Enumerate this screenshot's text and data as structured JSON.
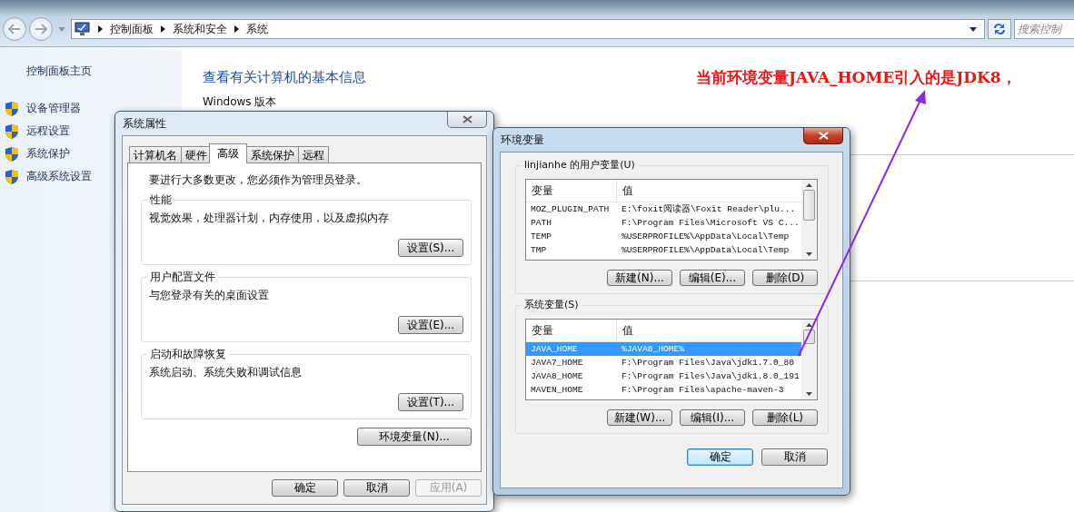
{
  "explorer": {
    "breadcrumb": [
      "控制面板",
      "系统和安全",
      "系统"
    ],
    "search": {
      "placeholder": "搜索控制"
    }
  },
  "sidebar": {
    "home_link": "控制面板主页",
    "items": [
      "设备管理器",
      "远程设置",
      "系统保护",
      "高级系统设置"
    ]
  },
  "main": {
    "heading": "查看有关计算机的基本信息",
    "section": "Windows 版本"
  },
  "annotation": "当前环境变量JAVA_HOME引入的是JDK8，",
  "system_properties": {
    "title": "系统属性",
    "tabs": [
      {
        "label": "计算机名",
        "selected": false
      },
      {
        "label": "硬件",
        "selected": false
      },
      {
        "label": "高级",
        "selected": true
      },
      {
        "label": "系统保护",
        "selected": false
      },
      {
        "label": "远程",
        "selected": false
      }
    ],
    "notice": "要进行大多数更改，您必须作为管理员登录。",
    "groups": [
      {
        "title": "性能",
        "description": "视觉效果，处理器计划，内存使用，以及虚拟内存",
        "button": "设置(S)..."
      },
      {
        "title": "用户配置文件",
        "description": "与您登录有关的桌面设置",
        "button": "设置(E)..."
      },
      {
        "title": "启动和故障恢复",
        "description": "系统启动、系统失败和调试信息",
        "button": "设置(T)..."
      }
    ],
    "env_button": "环境变量(N)...",
    "buttons": [
      {
        "label": "确定",
        "disabled": false
      },
      {
        "label": "取消",
        "disabled": false
      },
      {
        "label": "应用(A)",
        "disabled": true
      }
    ]
  },
  "environment_variables": {
    "title": "环境变量",
    "sections": [
      {
        "title": "linjianhe 的用户变量(U)",
        "columns": [
          "变量",
          "值"
        ],
        "rows": [
          {
            "name": "MOZ_PLUGIN_PATH",
            "value": "E:\\foxit阅读器\\Foxit Reader\\plu...",
            "selected": false
          },
          {
            "name": "PATH",
            "value": "F:\\Program Files\\Microsoft VS C...",
            "selected": false
          },
          {
            "name": "TEMP",
            "value": "%USERPROFILE%\\AppData\\Local\\Temp",
            "selected": false
          },
          {
            "name": "TMP",
            "value": "%USERPROFILE%\\AppData\\Local\\Temp",
            "selected": false
          }
        ],
        "buttons": [
          "新建(N)...",
          "编辑(E)...",
          "删除(D)"
        ]
      },
      {
        "title": "系统变量(S)",
        "columns": [
          "变量",
          "值"
        ],
        "rows": [
          {
            "name": "JAVA_HOME",
            "value": "%JAVA8_HOME%",
            "selected": true
          },
          {
            "name": "JAVA7_HOME",
            "value": "F:\\Program Files\\Java\\jdk1.7.0_80",
            "selected": false
          },
          {
            "name": "JAVA8_HOME",
            "value": "F:\\Program Files\\Java\\jdk1.8.0_191",
            "selected": false
          },
          {
            "name": "MAVEN_HOME",
            "value": "F:\\Program Files\\apache-maven-3",
            "selected": false
          }
        ],
        "buttons": [
          "新建(W)...",
          "编辑(I)...",
          "删除(L)"
        ]
      }
    ],
    "buttons": [
      {
        "label": "确定",
        "default": true
      },
      {
        "label": "取消",
        "default": false
      }
    ]
  }
}
